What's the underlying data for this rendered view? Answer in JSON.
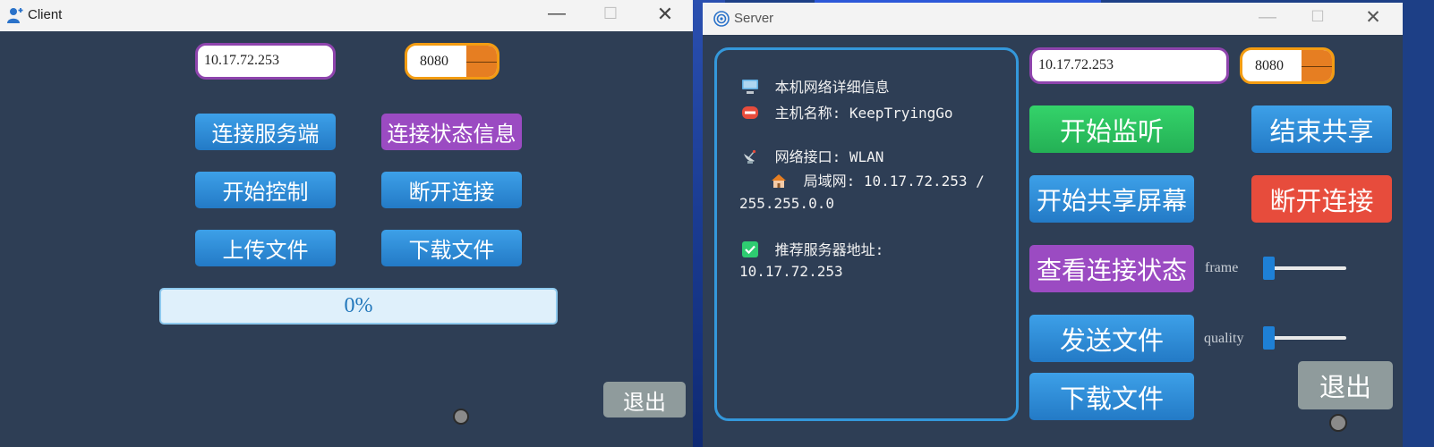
{
  "client": {
    "title": "Client",
    "ip_value": "10.17.72.253",
    "port_value": "8080",
    "buttons": {
      "connect_server": "连接服务端",
      "connection_status_info": "连接状态信息",
      "start_control": "开始控制",
      "disconnect": "断开连接",
      "upload_file": "上传文件",
      "download_file": "下载文件",
      "exit": "退出"
    },
    "progress_text": "0%"
  },
  "server": {
    "title": "Server",
    "info": {
      "heading": "本机网络详细信息",
      "hostname": "主机名称: KeepTryingGo",
      "interface": "网络接口: WLAN",
      "lan_part1": "局域网: 10.17.72.253 /",
      "lan_part2": "255.255.0.0",
      "recommended_label": "推荐服务器地址:",
      "recommended_value": "10.17.72.253"
    },
    "ip_value": "10.17.72.253",
    "port_value": "8080",
    "buttons": {
      "start_listen": "开始监听",
      "end_share": "结束共享",
      "start_share_screen": "开始共享屏幕",
      "disconnect": "断开连接",
      "view_connection_status": "查看连接状态",
      "send_file": "发送文件",
      "download_file": "下载文件",
      "exit": "退出"
    },
    "sliders": {
      "frame_label": "frame",
      "frame_value": 0,
      "quality_label": "quality",
      "quality_value": 0
    }
  },
  "colors": {
    "window_bg": "#2e3e55",
    "blue_button": "#2d8bd6",
    "purple_button": "#9b4bc2",
    "green_button": "#2ecc71",
    "red_button": "#e74c3c",
    "grey_button": "#8f9b9c",
    "field_border": "#8e44ad",
    "spin_border": "#f39c12"
  }
}
